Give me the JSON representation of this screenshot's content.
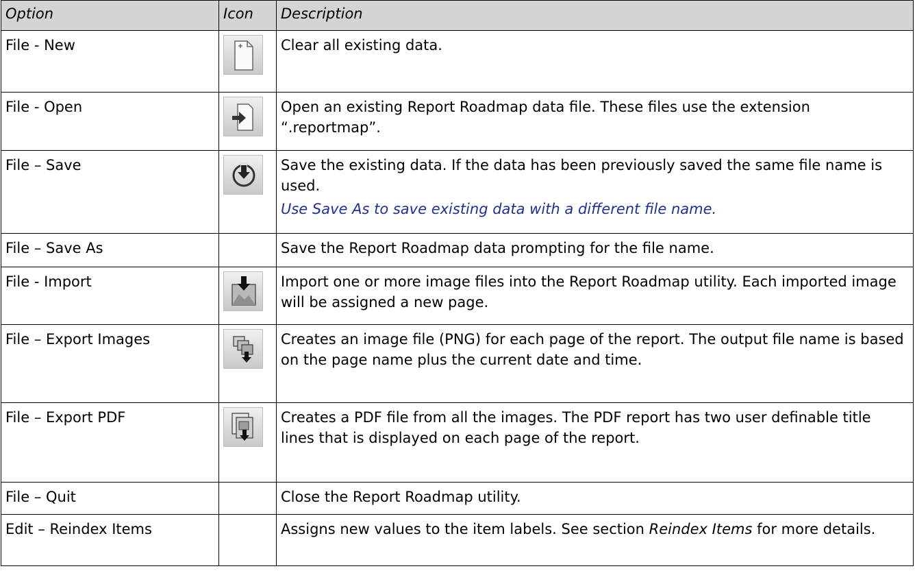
{
  "headers": {
    "option": "Option",
    "icon": "Icon",
    "description": "Description"
  },
  "rows": [
    {
      "option": "File - New",
      "icon": "new-file-icon",
      "description": "Clear all existing data."
    },
    {
      "option": "File - Open",
      "icon": "open-file-icon",
      "description": "Open an existing Report Roadmap data file.  These files use the extension “.reportmap”."
    },
    {
      "option": "File – Save",
      "icon": "save-icon",
      "description": "Save the existing data.  If the data has been previously saved the same file name is used.",
      "note": "Use Save As to save existing data with a different file name."
    },
    {
      "option": "File – Save As",
      "icon": "",
      "description": "Save the Report Roadmap data prompting for the file name."
    },
    {
      "option": "File - Import",
      "icon": "import-icon",
      "description": "Import one or more image files into the Report Roadmap utility.  Each imported image will be assigned a new page."
    },
    {
      "option": "File – Export Images",
      "icon": "export-images-icon",
      "description": "Creates an image file (PNG) for each page of the report.  The output file name is based on the page name plus the current date and time."
    },
    {
      "option": "File – Export PDF",
      "icon": "export-pdf-icon",
      "description": "Creates a PDF file from all the images.  The PDF report has two user definable title lines that is displayed on each page of the report."
    },
    {
      "option": "File – Quit",
      "icon": "",
      "description": "Close the Report Roadmap utility."
    },
    {
      "option": "Edit – Reindex Items",
      "icon": "",
      "description_before": "Assigns new values to the item labels.  See section ",
      "description_em": "Reindex Items",
      "description_after": " for more details."
    }
  ],
  "colors": {
    "header_bg": "#d4d4d4",
    "note_text": "#1e2f9e",
    "icon_bg": "#dcdcdc"
  }
}
